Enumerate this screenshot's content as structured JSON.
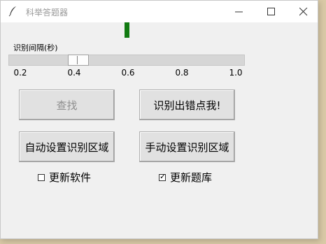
{
  "window": {
    "title": "科举答题器"
  },
  "titlebar_icons": {
    "app": "quill-icon",
    "minimize": "minimize-icon",
    "maximize": "maximize-icon",
    "close": "close-icon"
  },
  "indicator": {
    "color": "#117a11"
  },
  "slider": {
    "label": "识别间隔(秒)",
    "min": 0.2,
    "max": 1.0,
    "value": 0.42,
    "ticks": [
      "0.2",
      "0.4",
      "0.6",
      "0.8",
      "1.0"
    ]
  },
  "buttons": {
    "find": "查找",
    "wrong": "识别出错点我!",
    "auto_region": "自动设置识别区域",
    "manual_region": "手动设置识别区域"
  },
  "checkboxes": {
    "update_software": {
      "label": "更新软件",
      "checked": false
    },
    "update_db": {
      "label": "更新题库",
      "checked": true
    }
  }
}
